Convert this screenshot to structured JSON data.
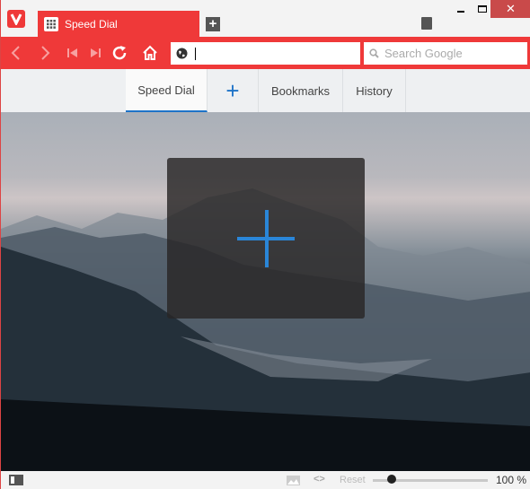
{
  "window": {
    "tab_title": "Speed Dial",
    "new_tab_symbol": "+",
    "close_symbol": "✕"
  },
  "toolbar": {
    "url_value": "",
    "search_placeholder": "Search Google"
  },
  "speed_dial_tabs": [
    {
      "label": "Speed Dial",
      "active": true
    },
    {
      "label": "+",
      "active": false
    },
    {
      "label": "Bookmarks",
      "active": false
    },
    {
      "label": "History",
      "active": false
    }
  ],
  "status_bar": {
    "reset_label": "Reset",
    "zoom_level": "100 %",
    "zoom_fraction": 0.15
  },
  "colors": {
    "accent": "#ef3939",
    "active_tab_underline": "#1e73c8",
    "add_icon": "#2a86d8"
  }
}
